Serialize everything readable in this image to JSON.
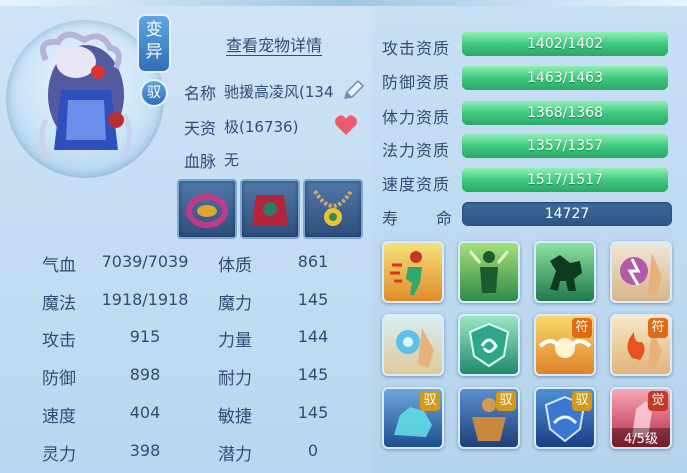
{
  "tags": {
    "variant": "变异",
    "tame": "驭"
  },
  "detail_link": "查看宠物详情",
  "info": {
    "name_label": "名称",
    "name_value": "驰援高凌风(134",
    "aptitude_label": "天资",
    "aptitude_value": "极(16736)",
    "bloodline_label": "血脉",
    "bloodline_value": "无"
  },
  "equipment": [
    "equip-collar-icon",
    "equip-armor-icon",
    "equip-necklace-icon"
  ],
  "stats_left": [
    {
      "label": "气血",
      "value": "7039/7039"
    },
    {
      "label": "魔法",
      "value": "1918/1918"
    },
    {
      "label": "攻击",
      "value": "915"
    },
    {
      "label": "防御",
      "value": "898"
    },
    {
      "label": "速度",
      "value": "404"
    },
    {
      "label": "灵力",
      "value": "398"
    }
  ],
  "stats_right": [
    {
      "label": "体质",
      "value": "861"
    },
    {
      "label": "魔力",
      "value": "145"
    },
    {
      "label": "力量",
      "value": "144"
    },
    {
      "label": "耐力",
      "value": "145"
    },
    {
      "label": "敏捷",
      "value": "145"
    },
    {
      "label": "潜力",
      "value": "0"
    }
  ],
  "aptitudes": [
    {
      "label": "攻击资质",
      "value": "1402/1402",
      "fill": 1.0
    },
    {
      "label": "防御资质",
      "value": "1463/1463",
      "fill": 1.0
    },
    {
      "label": "体力资质",
      "value": "1368/1368",
      "fill": 1.0
    },
    {
      "label": "法力资质",
      "value": "1357/1357",
      "fill": 1.0
    },
    {
      "label": "速度资质",
      "value": "1517/1517",
      "fill": 1.0
    }
  ],
  "life": {
    "label_1": "寿",
    "label_2": "命",
    "value": "14727"
  },
  "skills": [
    {
      "name": "skill-runner-icon"
    },
    {
      "name": "skill-shadow-figure-icon"
    },
    {
      "name": "skill-horse-icon"
    },
    {
      "name": "skill-hand-lightning-icon"
    },
    {
      "name": "skill-hand-orb-icon"
    },
    {
      "name": "skill-shield-swirl-icon"
    },
    {
      "name": "skill-winged-target-icon",
      "badge": "符"
    },
    {
      "name": "skill-hand-fire-icon",
      "badge": "符"
    },
    {
      "name": "skill-wolf-icon",
      "badge": "驭"
    },
    {
      "name": "skill-muscle-icon",
      "badge": "驭"
    },
    {
      "name": "skill-shield-icon",
      "badge": "驭"
    },
    {
      "name": "skill-awaken-icon",
      "badge": "觉",
      "level": "4/5级"
    }
  ]
}
